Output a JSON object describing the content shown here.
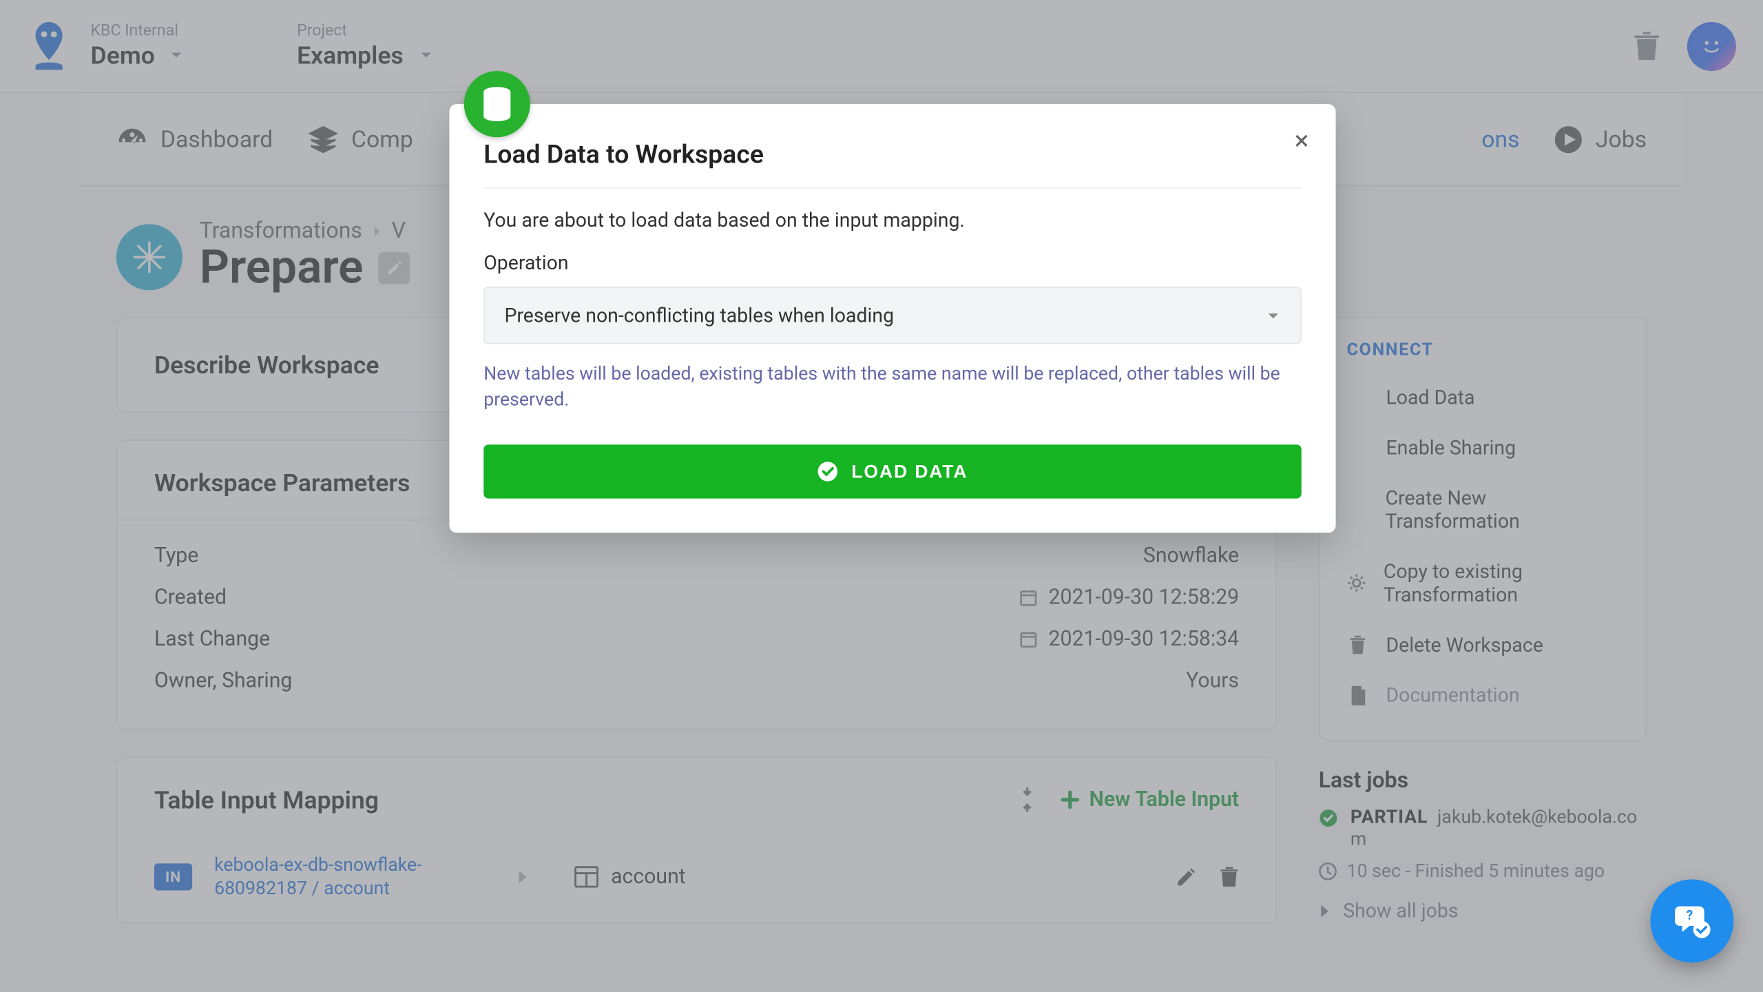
{
  "topbar": {
    "org_label": "KBC Internal",
    "org_name": "Demo",
    "project_label": "Project",
    "project_name": "Examples"
  },
  "nav": {
    "dashboard": "Dashboard",
    "components": "Comp",
    "transformations_partial": "ons",
    "jobs": "Jobs"
  },
  "breadcrumb": {
    "root": "Transformations",
    "page_title": "Prepare"
  },
  "describe": {
    "header": "Describe Workspace"
  },
  "params": {
    "header": "Workspace Parameters",
    "type_label": "Type",
    "type_value": "Snowflake",
    "created_label": "Created",
    "created_value": "2021-09-30 12:58:29",
    "last_change_label": "Last Change",
    "last_change_value": "2021-09-30 12:58:34",
    "owner_label": "Owner, Sharing",
    "owner_value": "Yours"
  },
  "mapping": {
    "header": "Table Input Mapping",
    "new_label": "New Table Input",
    "in_badge": "IN",
    "source": "keboola-ex-db-snowflake-680982187 / account",
    "dest": "account"
  },
  "sidebar": {
    "title": "CONNECT",
    "items": {
      "load_data": "Load Data",
      "enable_sharing": "Enable Sharing",
      "create_new": "Create New Transformation",
      "copy_existing": "Copy to existing Transformation",
      "delete_ws": "Delete Workspace",
      "documentation": "Documentation"
    }
  },
  "last_jobs": {
    "title": "Last jobs",
    "status": "PARTIAL",
    "user": "jakub.kotek@keboola.com",
    "time": "10 sec - Finished 5 minutes ago",
    "show_all": "Show all jobs"
  },
  "modal": {
    "title": "Load Data to Workspace",
    "intro": "You are about to load data based on the input mapping.",
    "operation_label": "Operation",
    "operation_value": "Preserve non-conflicting tables when loading",
    "helper": "New tables will be loaded, existing tables with the same name will be replaced, other tables will be preserved.",
    "button": "LOAD DATA"
  }
}
